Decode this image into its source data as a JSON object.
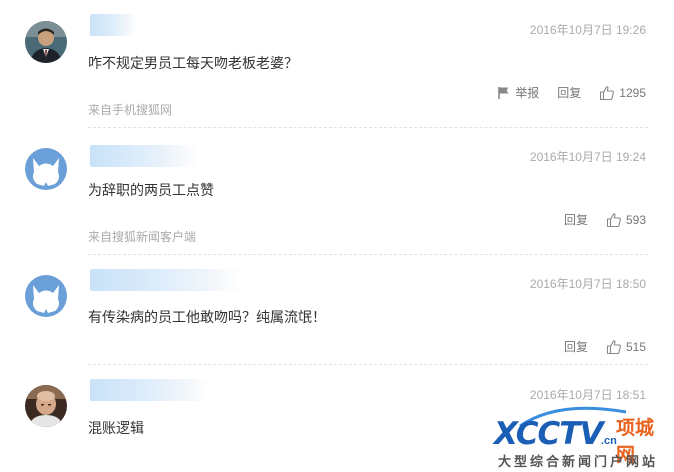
{
  "comments": [
    {
      "username": "",
      "time": "2016年10月7日 19:26",
      "content": "咋不规定男员工每天吻老板老婆？",
      "source": "来自手机搜狐网",
      "report_label": "举报",
      "reply_label": "回复",
      "likes": "1295",
      "avatar": "photo-man-suit"
    },
    {
      "username": "",
      "time": "2016年10月7日 19:24",
      "content": "为辞职的两员工点赞",
      "source": "来自搜狐新闻客户端",
      "reply_label": "回复",
      "likes": "593",
      "avatar": "default-fox-avatar"
    },
    {
      "username": "",
      "time": "2016年10月7日 18:50",
      "content": "有传染病的员工他敢吻吗？纯属流氓！",
      "reply_label": "回复",
      "likes": "515",
      "avatar": "default-fox-avatar"
    },
    {
      "username": "",
      "time": "2016年10月7日 18:51",
      "content": "混账逻辑",
      "avatar": "photo-bald-man"
    }
  ],
  "watermark": {
    "logo_text": "XCCTV",
    "logo_domain": ".cn",
    "brand": "项城网",
    "tagline": "大型综合新闻门户网站"
  },
  "colors": {
    "time_text": "#aaaaaa",
    "body_text": "#333333",
    "action_text": "#777777",
    "avatar_default": "#6a9fd8",
    "logo_blue": "#1a5fb5",
    "logo_orange": "#e8621e"
  }
}
